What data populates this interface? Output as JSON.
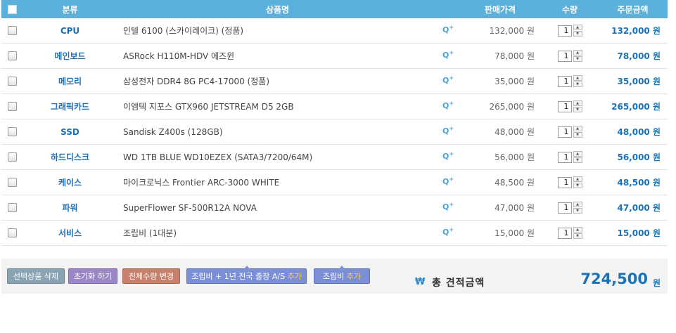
{
  "header": {
    "category": "분류",
    "product": "상품명",
    "price": "판매가격",
    "qty": "수량",
    "total": "주문금액"
  },
  "rows": [
    {
      "category": "CPU",
      "name": "인텔 6100 (스카이레이크) (정품)",
      "price": "132,000 원",
      "qty": "1",
      "total": "132,000 원"
    },
    {
      "category": "메인보드",
      "name": "ASRock H110M-HDV 에즈윈",
      "price": "78,000 원",
      "qty": "1",
      "total": "78,000 원"
    },
    {
      "category": "메모리",
      "name": "삼성전자 DDR4 8G PC4-17000 (정품)",
      "price": "35,000 원",
      "qty": "1",
      "total": "35,000 원"
    },
    {
      "category": "그래픽카드",
      "name": "이엠텍 지포스 GTX960 JETSTREAM D5 2GB",
      "price": "265,000 원",
      "qty": "1",
      "total": "265,000 원"
    },
    {
      "category": "SSD",
      "name": "Sandisk Z400s (128GB)",
      "price": "48,000 원",
      "qty": "1",
      "total": "48,000 원"
    },
    {
      "category": "하드디스크",
      "name": "WD 1TB BLUE WD10EZEX (SATA3/7200/64M)",
      "price": "56,000 원",
      "qty": "1",
      "total": "56,000 원"
    },
    {
      "category": "케이스",
      "name": "마이크로닉스 Frontier ARC-3000 WHITE",
      "price": "48,500 원",
      "qty": "1",
      "total": "48,500 원"
    },
    {
      "category": "파워",
      "name": "SuperFlower SF-500R12A NOVA",
      "price": "47,000 원",
      "qty": "1",
      "total": "47,000 원"
    },
    {
      "category": "서비스",
      "name": "조립비 (1대분)",
      "price": "15,000 원",
      "qty": "1",
      "total": "15,000 원"
    }
  ],
  "zoom_icon": {
    "label": "Q",
    "plus": "+"
  },
  "footer": {
    "delete_selected": "선택상품 삭제",
    "reset": "초기화 하기",
    "change_all_qty": "전체수량 변경",
    "assembly_as_prefix": "조립비 + 1년 전국 출장 A/S ",
    "assembly_as_add": "추가",
    "assembly_prefix": "조립비 ",
    "assembly_add": "추가",
    "won_symbol": "₩",
    "total_label": "총 견적금액",
    "total_value": "724,500",
    "total_unit": "원"
  },
  "colors": {
    "header_bg": "#5bb1dc",
    "accent": "#1a73b8",
    "category": "#1f6fb3"
  }
}
